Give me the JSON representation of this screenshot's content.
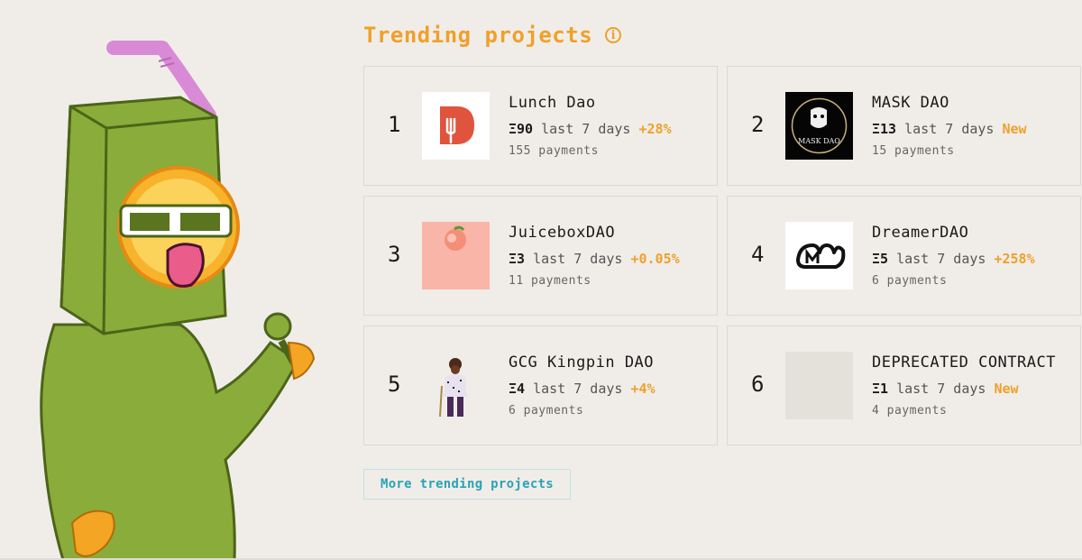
{
  "section": {
    "title": "Trending projects",
    "info_icon": "info-icon",
    "more_label": "More trending projects"
  },
  "colors": {
    "accent": "#f0a02a",
    "link": "#2aa3b5",
    "background": "#f0ede9",
    "card_border": "#dcd8d3"
  },
  "projects": [
    {
      "rank": "1",
      "name": "Lunch Dao",
      "eth": "Ξ90",
      "period": "last 7 days",
      "change": "+28%",
      "payments": "155 payments",
      "logo": "lunch-dao-logo",
      "logo_text": ""
    },
    {
      "rank": "2",
      "name": "MASK DAO",
      "eth": "Ξ13",
      "period": "last 7 days",
      "change": "New",
      "payments": "15 payments",
      "logo": "mask-dao-logo",
      "logo_text": "MASK DAO"
    },
    {
      "rank": "3",
      "name": "JuiceboxDAO",
      "eth": "Ξ3",
      "period": "last 7 days",
      "change": "+0.05%",
      "payments": "11 payments",
      "logo": "peach-logo",
      "logo_text": ""
    },
    {
      "rank": "4",
      "name": "DreamerDAO",
      "eth": "Ξ5",
      "period": "last 7 days",
      "change": "+258%",
      "payments": "6 payments",
      "logo": "dreamer-dao-logo",
      "logo_text": ""
    },
    {
      "rank": "5",
      "name": "GCG Kingpin DAO",
      "eth": "Ξ4",
      "period": "last 7 days",
      "change": "+4%",
      "payments": "6 payments",
      "logo": "gcg-kingpin-logo",
      "logo_text": ""
    },
    {
      "rank": "6",
      "name": "DEPRECATED CONTRACT",
      "eth": "Ξ1",
      "period": "last 7 days",
      "change": "New",
      "payments": "4 payments",
      "logo": "placeholder-logo",
      "logo_text": ""
    }
  ]
}
